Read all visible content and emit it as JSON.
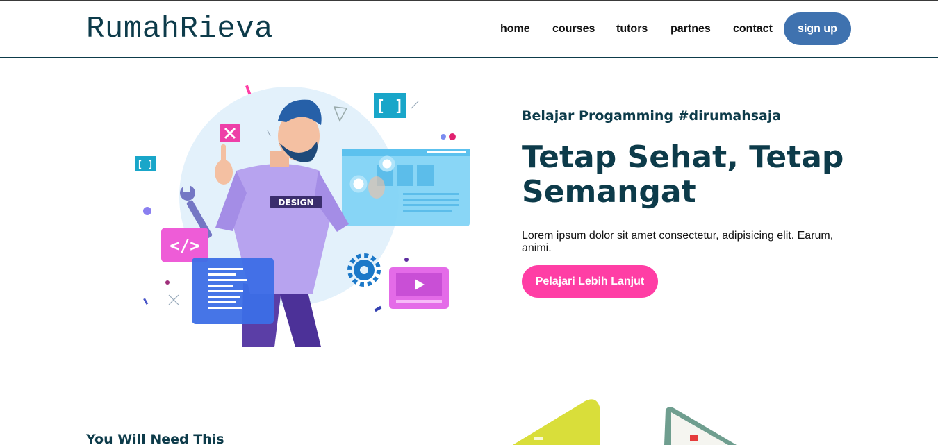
{
  "brand": "RumahRieva",
  "nav": {
    "items": [
      {
        "label": "home"
      },
      {
        "label": "courses"
      },
      {
        "label": "tutors"
      },
      {
        "label": "partnes"
      },
      {
        "label": "contact"
      }
    ],
    "signup_label": "sign up"
  },
  "hero": {
    "tagline": "Belajar Progamming #dirumahsaja",
    "headline": "Tetap Sehat, Tetap Semangat",
    "description": "Lorem ipsum dolor sit amet consectetur, adipisicing elit. Earum, animi.",
    "cta_label": "Pelajari Lebih Lanjut",
    "illustration_badge": "DESIGN"
  },
  "section2": {
    "title": "You Will Need This"
  },
  "colors": {
    "brand": "#0d3b4a",
    "signup": "#3f72af",
    "cta": "#ff3ea5"
  },
  "icons": [
    "code-icon",
    "play-icon",
    "close-icon",
    "gear-icon",
    "wrench-icon",
    "brackets-icon"
  ]
}
